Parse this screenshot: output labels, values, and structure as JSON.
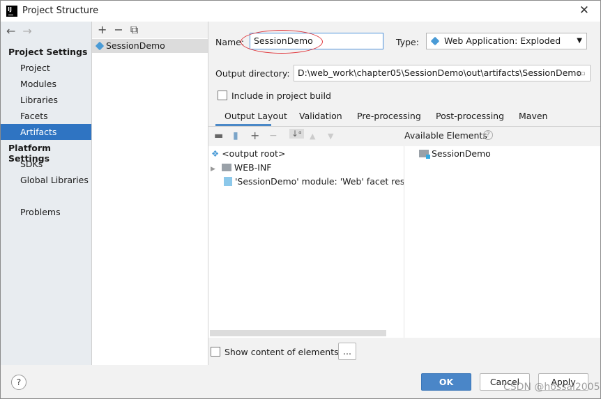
{
  "window": {
    "title": "Project Structure",
    "logo": "IJ"
  },
  "sidebar": {
    "sections": [
      {
        "title": "Project Settings",
        "items": [
          "Project",
          "Modules",
          "Libraries",
          "Facets",
          "Artifacts"
        ]
      },
      {
        "title": "Platform Settings",
        "items": [
          "SDKs",
          "Global Libraries"
        ]
      }
    ],
    "extra": "Problems",
    "selected": "Artifacts"
  },
  "artifacts": {
    "items": [
      "SessionDemo"
    ]
  },
  "form": {
    "name_label": "Name:",
    "name_value": "SessionDemo",
    "type_label": "Type:",
    "type_value": "Web Application: Exploded",
    "output_label": "Output directory:",
    "output_value": "D:\\web_work\\chapter05\\SessionDemo\\out\\artifacts\\SessionDemo",
    "include_label": "Include in project build",
    "include_checked": false
  },
  "tabs": [
    "Output Layout",
    "Validation",
    "Pre-processing",
    "Post-processing",
    "Maven"
  ],
  "layout": {
    "available_label": "Available Elements",
    "tree": [
      "<output root>",
      "WEB-INF",
      "'SessionDemo' module: 'Web' facet resou"
    ],
    "available": [
      "SessionDemo"
    ],
    "show_content_label": "Show content of elements",
    "ellipsis": "..."
  },
  "buttons": {
    "ok": "OK",
    "cancel": "Cancel",
    "apply": "Apply",
    "help": "?"
  },
  "watermark": "CSDN @hossai2005",
  "colors": {
    "accent": "#2f74c2",
    "annotation": "#e0393e"
  }
}
